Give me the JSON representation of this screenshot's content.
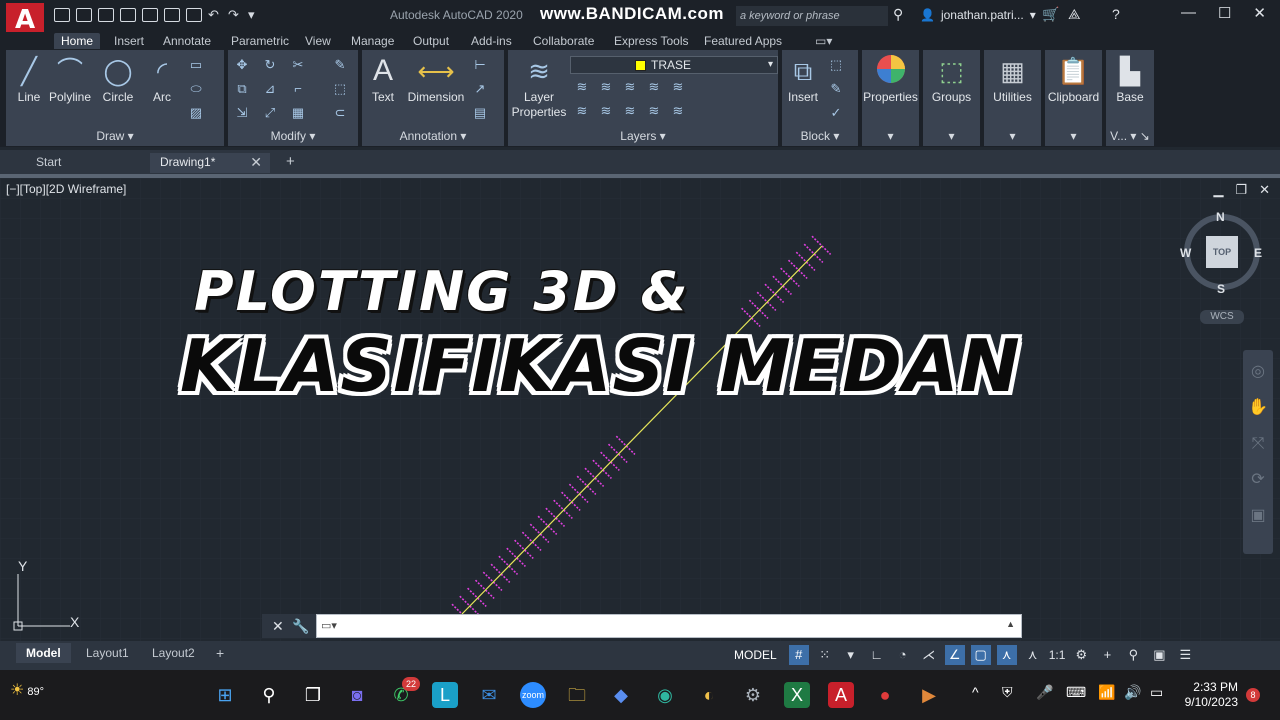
{
  "app": {
    "logo_letter": "A",
    "title": "Autodesk AutoCAD 2020",
    "watermark": "www.BANDICAM.com",
    "search_placeholder": "a keyword or phrase",
    "user_name": "jonathan.patri..."
  },
  "ribbon_tabs": [
    "Home",
    "Insert",
    "Annotate",
    "Parametric",
    "View",
    "Manage",
    "Output",
    "Add-ins",
    "Collaborate",
    "Express Tools",
    "Featured Apps"
  ],
  "panels": {
    "draw": {
      "title": "Draw",
      "tools": [
        "Line",
        "Polyline",
        "Circle",
        "Arc"
      ]
    },
    "modify": {
      "title": "Modify"
    },
    "annotation": {
      "title": "Annotation",
      "tools": [
        "Text",
        "Dimension"
      ]
    },
    "layers": {
      "title": "Layers",
      "tool": "Layer Properties",
      "current_layer": "TRASE",
      "current_layer_color": "#ffff00"
    },
    "block": {
      "title": "Block",
      "tool": "Insert"
    },
    "properties": {
      "tool": "Properties"
    },
    "groups": {
      "tool": "Groups"
    },
    "utilities": {
      "tool": "Utilities"
    },
    "clipboard": {
      "tool": "Clipboard"
    },
    "view": {
      "tool": "Base",
      "title": "V..."
    }
  },
  "file_tabs": [
    {
      "label": "Start"
    },
    {
      "label": "Drawing1*"
    }
  ],
  "viewport": {
    "label": "[−][Top][2D Wireframe]",
    "viewcube": {
      "face": "TOP",
      "north": "N",
      "south": "S",
      "east": "E",
      "west": "W",
      "wcs": "WCS"
    },
    "ucs": {
      "x": "X",
      "y": "Y"
    }
  },
  "overlay": {
    "line1": "PLOTTING 3D &",
    "line2": "KLASIFIKASI MEDAN"
  },
  "command_line": {
    "value": ""
  },
  "layout_tabs": [
    "Model",
    "Layout1",
    "Layout2"
  ],
  "status_bar": {
    "model": "MODEL",
    "scale": "1:1"
  },
  "taskbar": {
    "temperature": "89°",
    "whatsapp_badge": "22",
    "time": "2:33 PM",
    "date": "9/10/2023",
    "notifications": "8"
  },
  "colors": {
    "alignment_line": "#e6e65a",
    "cross_sections": "#e040e0",
    "accent": "#3d6fa8",
    "autocad_red": "#c8202b"
  }
}
